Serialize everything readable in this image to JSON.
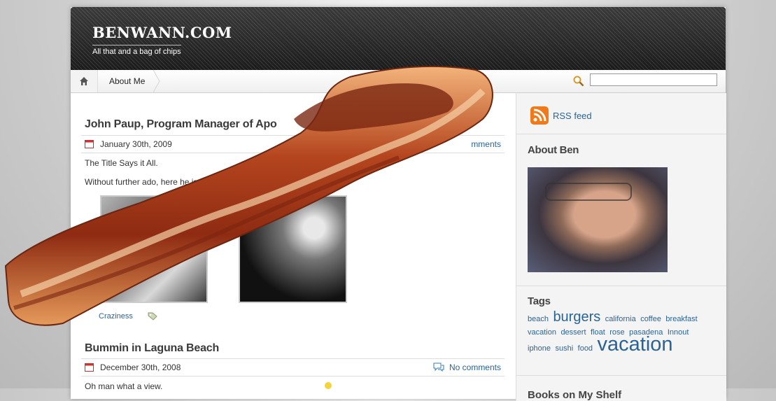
{
  "site": {
    "title": "BENWANN.COM",
    "tagline": "All that and a bag of chips"
  },
  "nav": {
    "home_icon": "home-icon",
    "about_label": "About Me",
    "search_placeholder": ""
  },
  "posts": [
    {
      "title": "John Paup, Program Manager of Apo",
      "date": "January 30th, 2009",
      "comments": "mments",
      "paragraphs": [
        "The Title Says it All.",
        "Without further ado, here he is"
      ],
      "category": "Craziness"
    },
    {
      "title": "Bummin in Laguna Beach",
      "date": "December 30th, 2008",
      "comments": "No comments",
      "paragraphs": [
        "Oh man what a view."
      ]
    }
  ],
  "sidebar": {
    "rss_label": "RSS feed",
    "about_heading": "About Ben",
    "tags_heading": "Tags",
    "tags": [
      {
        "text": "beach",
        "size": 11
      },
      {
        "text": "burgers",
        "size": 20
      },
      {
        "text": "california",
        "size": 11
      },
      {
        "text": "coffee",
        "size": 11
      },
      {
        "text": "breakfast",
        "size": 11
      },
      {
        "text": "vacation",
        "size": 11
      },
      {
        "text": "dessert",
        "size": 11
      },
      {
        "text": "float",
        "size": 11
      },
      {
        "text": "rose",
        "size": 11
      },
      {
        "text": "pasadena",
        "size": 11
      },
      {
        "text": "Innout",
        "size": 11
      },
      {
        "text": "iphone",
        "size": 11
      },
      {
        "text": "sushi",
        "size": 11
      },
      {
        "text": "food",
        "size": 11
      },
      {
        "text": "vacation",
        "size": 29
      }
    ],
    "books_heading": "Books on My Shelf"
  },
  "colors": {
    "link": "#2a6496",
    "header": "#1b1b1b"
  }
}
